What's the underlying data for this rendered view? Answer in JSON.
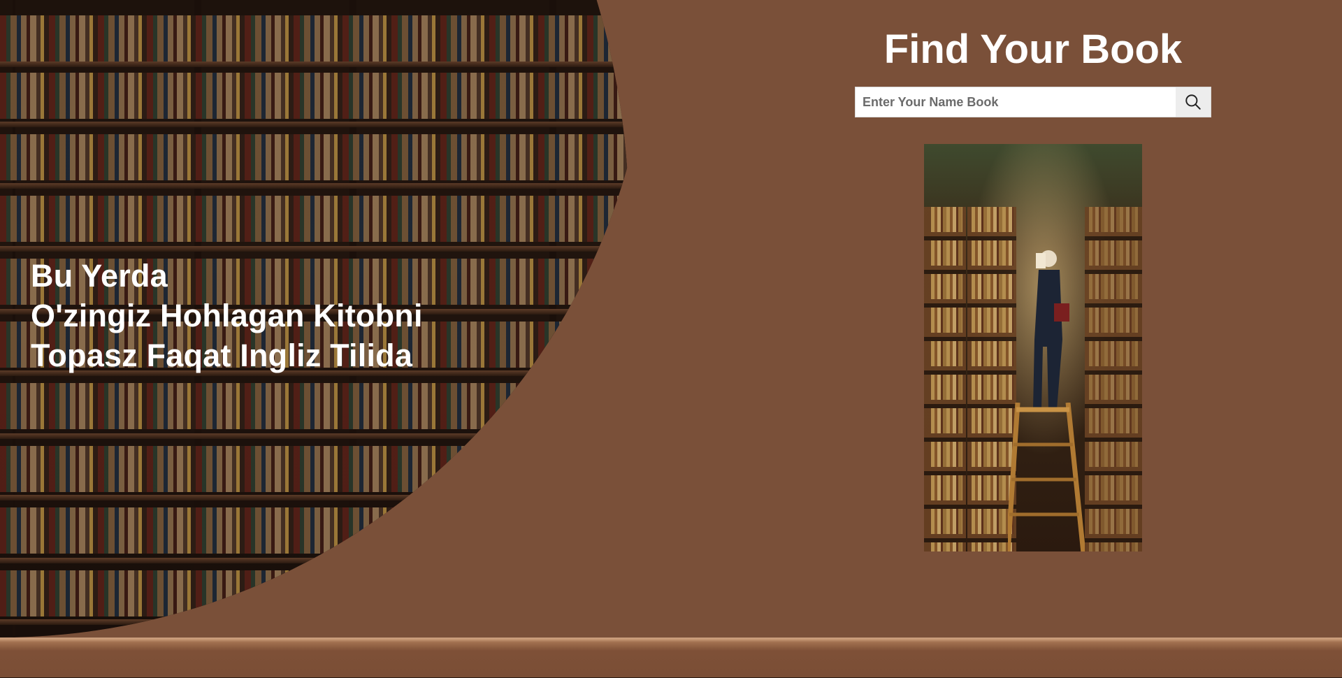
{
  "hero": {
    "lines": [
      "Bu Yerda",
      "O'zingiz Hohlagan Kitobni",
      "Topasz Faqat Ingliz Tilida"
    ]
  },
  "header": {
    "title": "Find Your Book"
  },
  "search": {
    "placeholder": "Enter Your Name Book",
    "value": "",
    "button_icon": "search-icon"
  },
  "colors": {
    "background": "#7a5039",
    "text": "#ffffff",
    "search_button": "#ededed"
  },
  "images": {
    "hero_background": "bookshelves",
    "feature_painting": "man-reading-on-library-ladder"
  }
}
